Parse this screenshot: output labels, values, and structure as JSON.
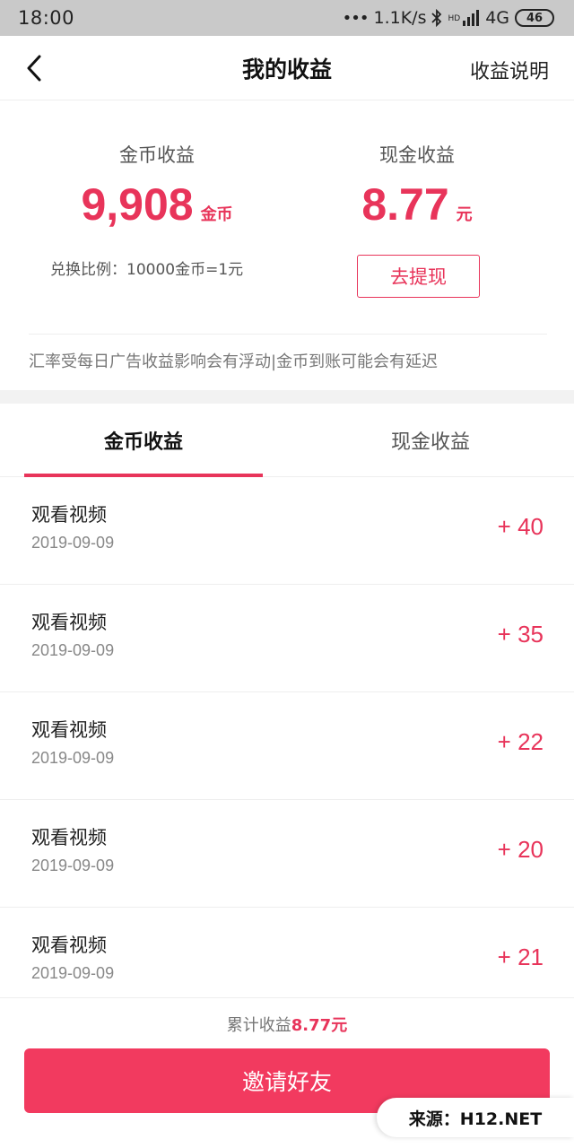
{
  "status_bar": {
    "time": "18:00",
    "dots": "•••",
    "speed": "1.1K/s",
    "hd": "HD",
    "network": "4G",
    "battery": "46"
  },
  "nav": {
    "title": "我的收益",
    "right_link": "收益说明"
  },
  "summary": {
    "coins_label": "金币收益",
    "coins_value": "9,908",
    "coins_unit": "金币",
    "cash_label": "现金收益",
    "cash_value": "8.77",
    "cash_unit": "元",
    "ratio_text": "兑换比例：10000金币=1元",
    "withdraw_label": "去提现",
    "notice": "汇率受每日广告收益影响会有浮动|金币到账可能会有延迟"
  },
  "tabs": [
    {
      "label": "金币收益",
      "active": true
    },
    {
      "label": "现金收益",
      "active": false
    }
  ],
  "records": [
    {
      "title": "观看视频",
      "date": "2019-09-09",
      "amount": "+ 40"
    },
    {
      "title": "观看视频",
      "date": "2019-09-09",
      "amount": "+ 35"
    },
    {
      "title": "观看视频",
      "date": "2019-09-09",
      "amount": "+ 22"
    },
    {
      "title": "观看视频",
      "date": "2019-09-09",
      "amount": "+ 20"
    },
    {
      "title": "观看视频",
      "date": "2019-09-09",
      "amount": "+ 21"
    }
  ],
  "footer": {
    "total_prefix": "累计收益",
    "total_amount": "8.77元",
    "invite_label": "邀请好友"
  },
  "watermark": "来源：H12.NET",
  "colors": {
    "accent": "#e8345a",
    "button": "#f23a5f",
    "status_bar": "#c9c9c9"
  }
}
